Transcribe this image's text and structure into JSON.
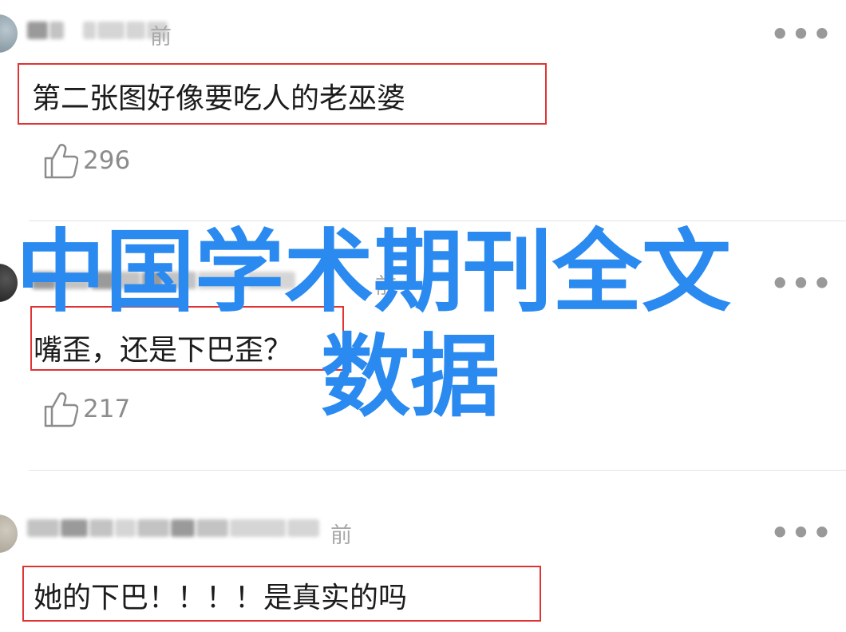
{
  "comments": [
    {
      "timestamp_suffix": "前",
      "text": "第二张图好像要吃人的老巫婆",
      "likes": "296"
    },
    {
      "timestamp_suffix": "前",
      "text": "嘴歪，还是下巴歪？",
      "likes": "217"
    },
    {
      "timestamp_suffix": "前",
      "text": "她的下巴！！！！是真实的吗",
      "likes": ""
    }
  ],
  "more_label": "•••",
  "watermark": {
    "line1": "中国学术期刊全文",
    "line2": "数据"
  },
  "colors": {
    "highlight_border": "#e03333",
    "watermark": "#2a8af0",
    "muted_text": "#8c8c8c"
  },
  "icons": {
    "like": "thumbs-up-icon",
    "more": "more-dots-icon"
  }
}
